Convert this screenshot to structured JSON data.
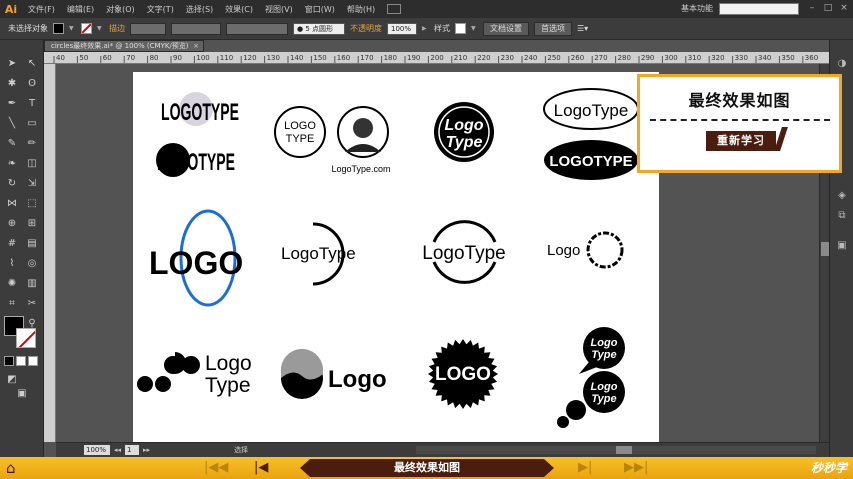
{
  "menubar": {
    "app_logo": "Ai",
    "items": [
      "文件(F)",
      "编辑(E)",
      "对象(O)",
      "文字(T)",
      "选择(S)",
      "效果(C)",
      "视图(V)",
      "窗口(W)",
      "帮助(H)"
    ],
    "workspace": "基本功能",
    "window_buttons": [
      "–",
      "□",
      "×"
    ]
  },
  "controlbar": {
    "selection_label": "未选择对象",
    "stroke_label": "描边",
    "brush_label": "5 点圆形",
    "opacity_label": "不透明度",
    "opacity_value": "100%",
    "style_label": "样式",
    "doc_settings_button": "文档设置",
    "preferences_button": "首选项",
    "fill_color": "#000000",
    "stroke_color": "#d00000"
  },
  "document": {
    "tab_title": "circles最终效果.ai* @ 100% (CMYK/预览)",
    "ruler_ticks": [
      "40",
      "50",
      "60",
      "70",
      "80",
      "90",
      "100",
      "110",
      "120",
      "130",
      "140",
      "150",
      "160",
      "170",
      "180",
      "190",
      "200",
      "210",
      "220",
      "230",
      "240",
      "250",
      "260",
      "270",
      "280",
      "290",
      "300",
      "310",
      "320",
      "330",
      "340",
      "350",
      "360"
    ]
  },
  "artboard": {
    "logos": [
      {
        "text": "LOGOTYPE",
        "variant": "bold-with-circle"
      },
      {
        "text": "LOGOTYPE",
        "variant": "black-circle"
      },
      {
        "text_lines": [
          "LOGO",
          "TYPE"
        ],
        "variant": "outline-circle"
      },
      {
        "text": "LogoType.com",
        "variant": "portrait-caption"
      },
      {
        "text_lines": [
          "Logo",
          "Type"
        ],
        "variant": "black-badge"
      },
      {
        "text": "LogoType",
        "variant": "outline-ellipse"
      },
      {
        "text": "LOGOTYPE",
        "variant": "black-ellipse"
      },
      {
        "text": "LOGO",
        "variant": "blue-ring"
      },
      {
        "text": "LogoType",
        "variant": "ring-arc"
      },
      {
        "text": "LogoType",
        "variant": "split-ring"
      },
      {
        "text": "Logo",
        "variant": "rough-ring"
      },
      {
        "text_lines": [
          "Logo",
          "Type"
        ],
        "variant": "dots"
      },
      {
        "text": "Logo",
        "variant": "wave-circle"
      },
      {
        "text": "LOGO",
        "variant": "starburst"
      },
      {
        "text_lines": [
          "Logo",
          "Type"
        ],
        "variant": "speech-bubbles-1"
      },
      {
        "text_lines": [
          "Logo",
          "Type"
        ],
        "variant": "speech-bubbles-2"
      }
    ]
  },
  "result_panel": {
    "title": "最终效果如图",
    "relearn_button": "重新学习"
  },
  "statusbar": {
    "zoom": "100%",
    "page": "1",
    "tool_status": "选择"
  },
  "player": {
    "center_title": "最终效果如图",
    "brand": "秒秒学",
    "accent_color": "#f5a623",
    "banner_color": "#4a1d0f"
  }
}
